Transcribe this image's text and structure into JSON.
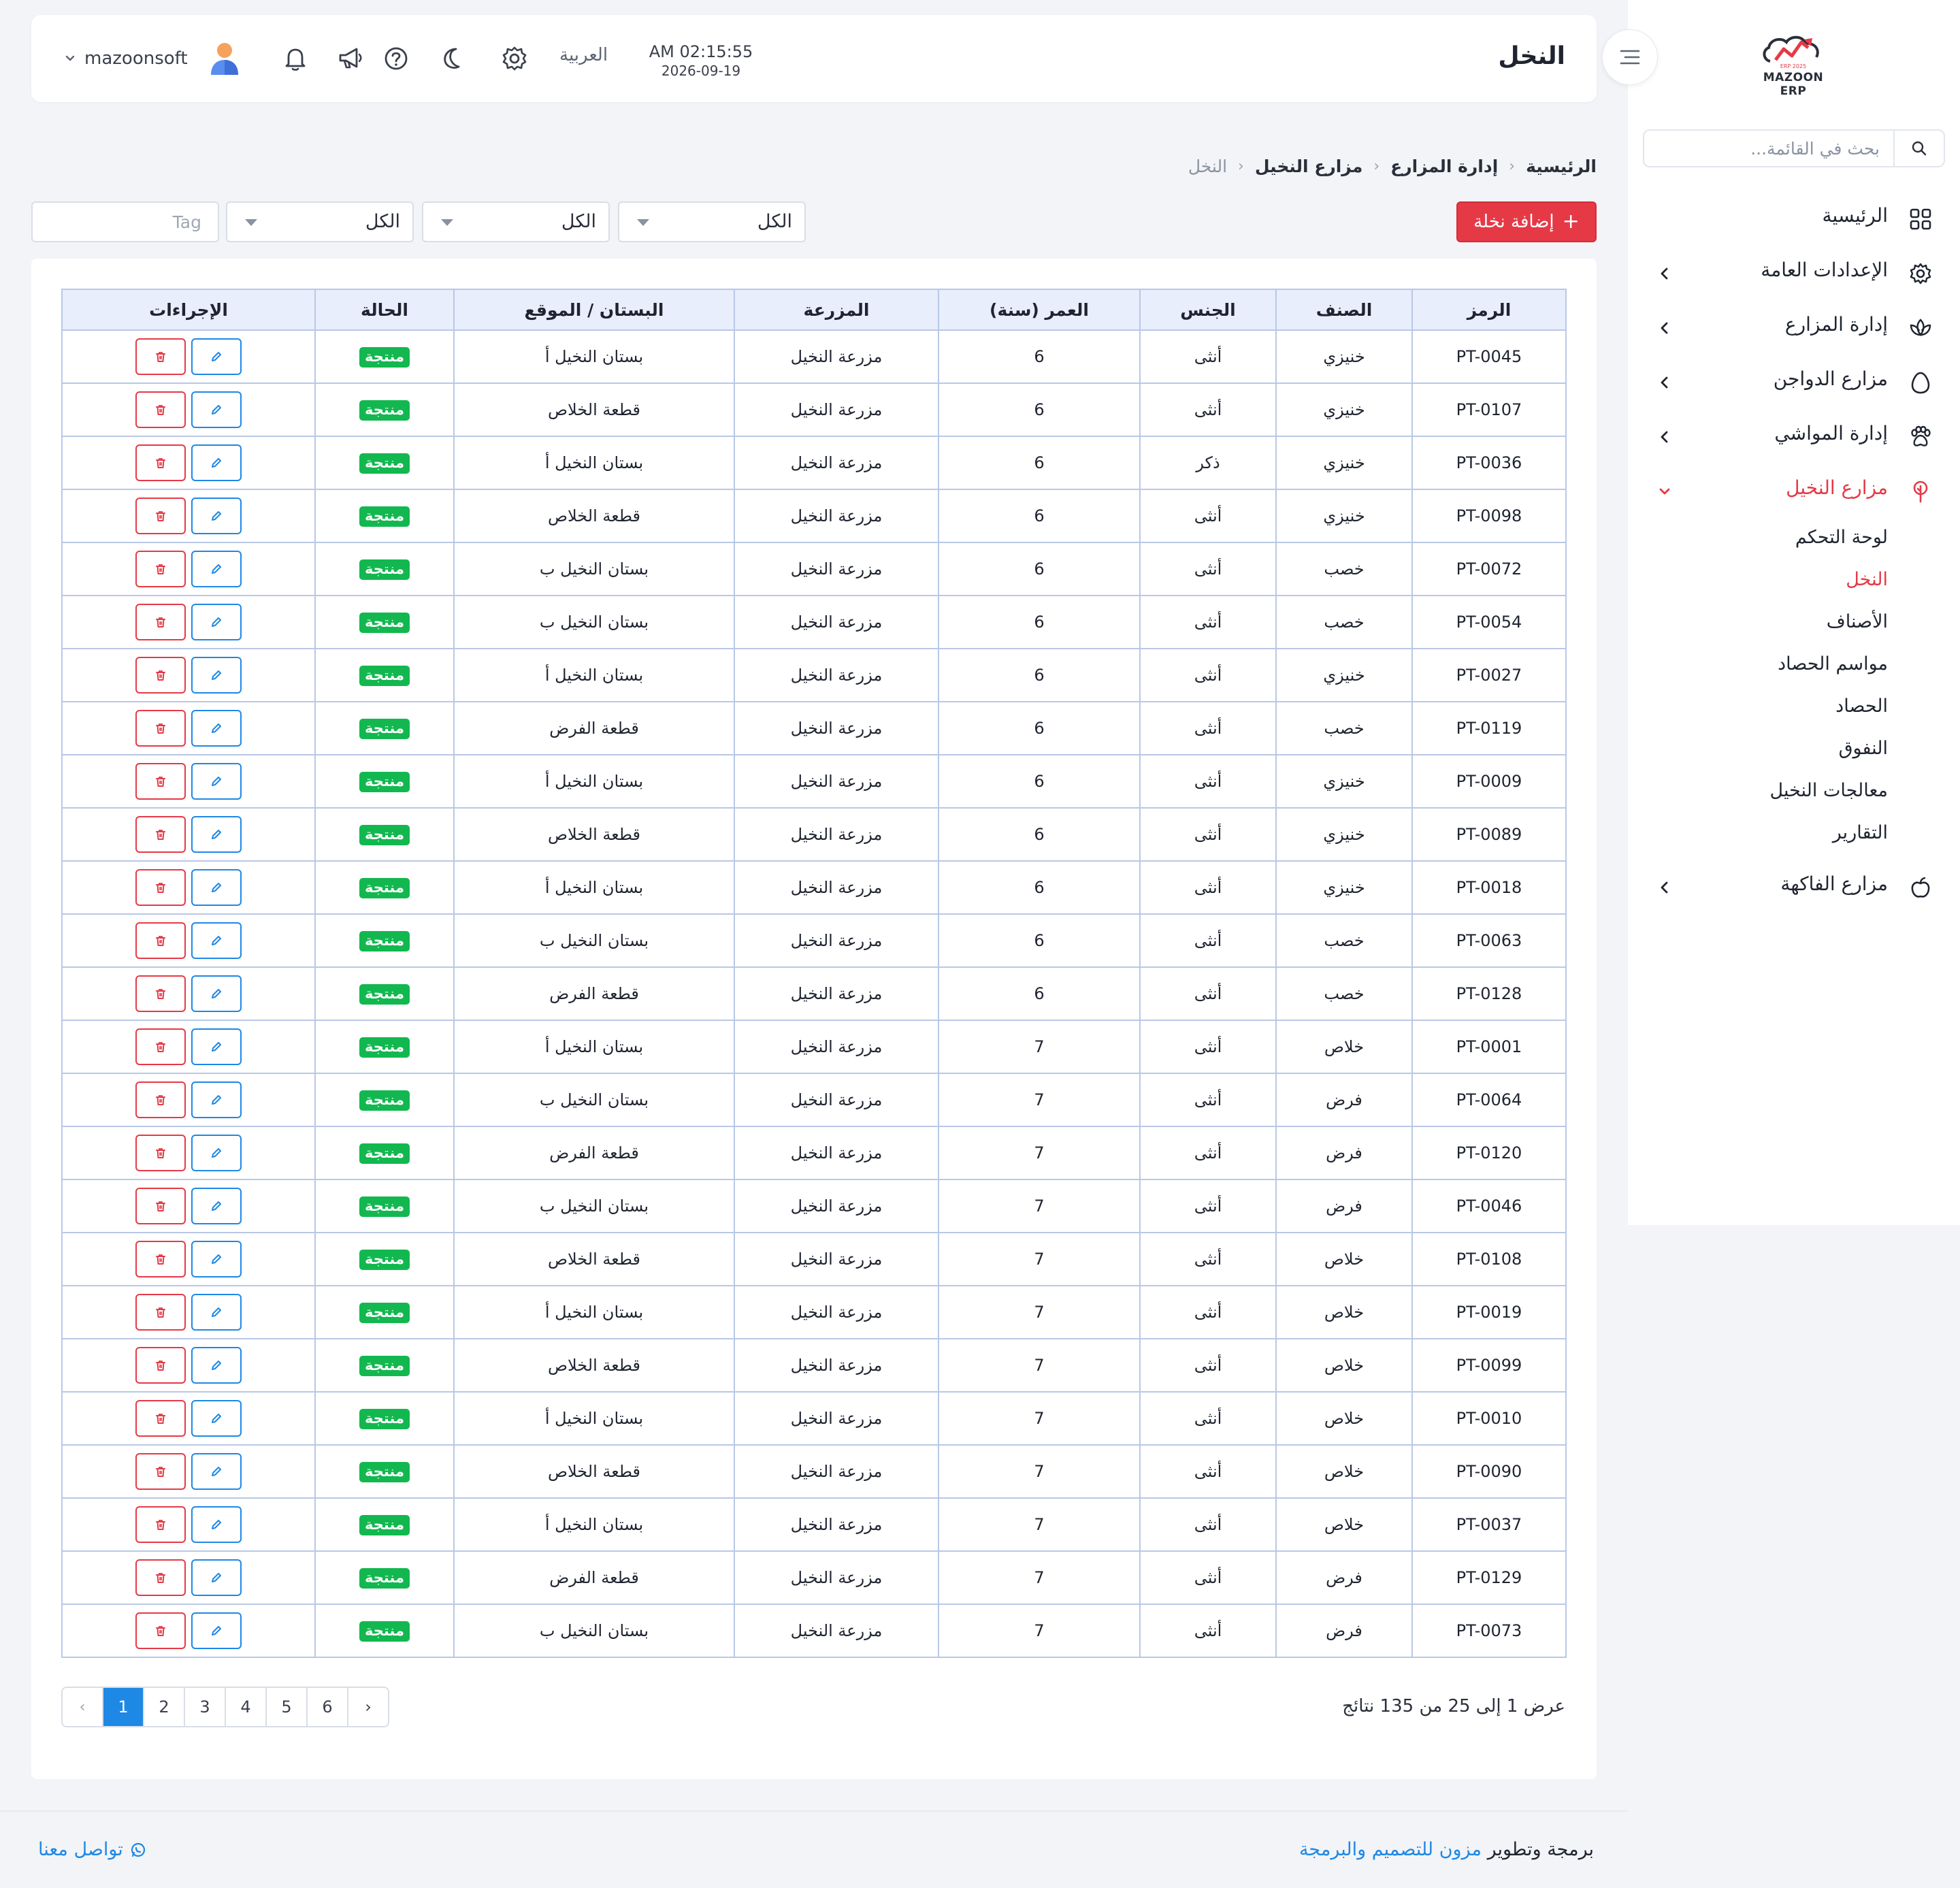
{
  "app": {
    "logo_text": "MAZOON ERP",
    "logo_small": "ERP 2025"
  },
  "sidebar": {
    "search_placeholder": "بحث في القائمة...",
    "items": [
      {
        "label": "الرئيسية",
        "icon": "grid-icon",
        "expandable": false
      },
      {
        "label": "الإعدادات العامة",
        "icon": "gear-icon",
        "expandable": true
      },
      {
        "label": "إدارة المزارع",
        "icon": "lotus-icon",
        "expandable": true
      },
      {
        "label": "مزارع الدواجن",
        "icon": "egg-icon",
        "expandable": true
      },
      {
        "label": "إدارة المواشي",
        "icon": "paw-icon",
        "expandable": true
      },
      {
        "label": "مزارع النخيل",
        "icon": "tree-icon",
        "expandable": true,
        "active": true
      },
      {
        "label": "مزارع الفاكهة",
        "icon": "apple-icon",
        "expandable": true
      }
    ],
    "palm_sub_items": [
      {
        "label": "لوحة التحكم"
      },
      {
        "label": "النخل",
        "active": true
      },
      {
        "label": "الأصناف"
      },
      {
        "label": "مواسم الحصاد"
      },
      {
        "label": "الحصاد"
      },
      {
        "label": "النفوق"
      },
      {
        "label": "معالجات النخيل"
      },
      {
        "label": "التقارير"
      }
    ]
  },
  "topbar": {
    "title": "النخل",
    "time": "AM 02:15:55",
    "date": "2026-09-19",
    "language": "العربية",
    "username": "mazoonsoft"
  },
  "breadcrumb": [
    "الرئيسية",
    "إدارة المزارع",
    "مزارع النخيل",
    "النخل"
  ],
  "toolbar": {
    "add_label": "إضافة نخلة",
    "filters": [
      "الكل",
      "الكل",
      "الكل"
    ],
    "tag_placeholder": "Tag"
  },
  "table": {
    "headers": [
      "الرمز",
      "الصنف",
      "الجنس",
      "العمر (سنة)",
      "المزرعة",
      "البستان / الموقع",
      "الحالة",
      "الإجراءات"
    ],
    "rows": [
      [
        "PT-0045",
        "خنيزي",
        "أنثى",
        "6",
        "مزرعة النخيل",
        "بستان النخيل أ",
        "منتجة"
      ],
      [
        "PT-0107",
        "خنيزي",
        "أنثى",
        "6",
        "مزرعة النخيل",
        "قطعة الخلاص",
        "منتجة"
      ],
      [
        "PT-0036",
        "خنيزي",
        "ذكر",
        "6",
        "مزرعة النخيل",
        "بستان النخيل أ",
        "منتجة"
      ],
      [
        "PT-0098",
        "خنيزي",
        "أنثى",
        "6",
        "مزرعة النخيل",
        "قطعة الخلاص",
        "منتجة"
      ],
      [
        "PT-0072",
        "خصب",
        "أنثى",
        "6",
        "مزرعة النخيل",
        "بستان النخيل ب",
        "منتجة"
      ],
      [
        "PT-0054",
        "خصب",
        "أنثى",
        "6",
        "مزرعة النخيل",
        "بستان النخيل ب",
        "منتجة"
      ],
      [
        "PT-0027",
        "خنيزي",
        "أنثى",
        "6",
        "مزرعة النخيل",
        "بستان النخيل أ",
        "منتجة"
      ],
      [
        "PT-0119",
        "خصب",
        "أنثى",
        "6",
        "مزرعة النخيل",
        "قطعة الفرض",
        "منتجة"
      ],
      [
        "PT-0009",
        "خنيزي",
        "أنثى",
        "6",
        "مزرعة النخيل",
        "بستان النخيل أ",
        "منتجة"
      ],
      [
        "PT-0089",
        "خنيزي",
        "أنثى",
        "6",
        "مزرعة النخيل",
        "قطعة الخلاص",
        "منتجة"
      ],
      [
        "PT-0018",
        "خنيزي",
        "أنثى",
        "6",
        "مزرعة النخيل",
        "بستان النخيل أ",
        "منتجة"
      ],
      [
        "PT-0063",
        "خصب",
        "أنثى",
        "6",
        "مزرعة النخيل",
        "بستان النخيل ب",
        "منتجة"
      ],
      [
        "PT-0128",
        "خصب",
        "أنثى",
        "6",
        "مزرعة النخيل",
        "قطعة الفرض",
        "منتجة"
      ],
      [
        "PT-0001",
        "خلاص",
        "أنثى",
        "7",
        "مزرعة النخيل",
        "بستان النخيل أ",
        "منتجة"
      ],
      [
        "PT-0064",
        "فرض",
        "أنثى",
        "7",
        "مزرعة النخيل",
        "بستان النخيل ب",
        "منتجة"
      ],
      [
        "PT-0120",
        "فرض",
        "أنثى",
        "7",
        "مزرعة النخيل",
        "قطعة الفرض",
        "منتجة"
      ],
      [
        "PT-0046",
        "فرض",
        "أنثى",
        "7",
        "مزرعة النخيل",
        "بستان النخيل ب",
        "منتجة"
      ],
      [
        "PT-0108",
        "خلاص",
        "أنثى",
        "7",
        "مزرعة النخيل",
        "قطعة الخلاص",
        "منتجة"
      ],
      [
        "PT-0019",
        "خلاص",
        "أنثى",
        "7",
        "مزرعة النخيل",
        "بستان النخيل أ",
        "منتجة"
      ],
      [
        "PT-0099",
        "خلاص",
        "أنثى",
        "7",
        "مزرعة النخيل",
        "قطعة الخلاص",
        "منتجة"
      ],
      [
        "PT-0010",
        "خلاص",
        "أنثى",
        "7",
        "مزرعة النخيل",
        "بستان النخيل أ",
        "منتجة"
      ],
      [
        "PT-0090",
        "خلاص",
        "أنثى",
        "7",
        "مزرعة النخيل",
        "قطعة الخلاص",
        "منتجة"
      ],
      [
        "PT-0037",
        "خلاص",
        "أنثى",
        "7",
        "مزرعة النخيل",
        "بستان النخيل أ",
        "منتجة"
      ],
      [
        "PT-0129",
        "فرض",
        "أنثى",
        "7",
        "مزرعة النخيل",
        "قطعة الفرض",
        "منتجة"
      ],
      [
        "PT-0073",
        "فرض",
        "أنثى",
        "7",
        "مزرعة النخيل",
        "بستان النخيل ب",
        "منتجة"
      ]
    ]
  },
  "pagination": {
    "summary": "عرض 1 إلى 25 من 135 نتائج",
    "pages": [
      "1",
      "2",
      "3",
      "4",
      "5",
      "6"
    ],
    "current": "1",
    "prev": "‹",
    "next": "›"
  },
  "footer": {
    "credit_prefix": "برمجة وتطوير",
    "credit_link": "مزون للتصميم والبرمجة",
    "contact": "تواصل معنا"
  },
  "colors": {
    "accent": "#e63946",
    "link": "#1e88e5",
    "status_green": "#12b84f"
  }
}
